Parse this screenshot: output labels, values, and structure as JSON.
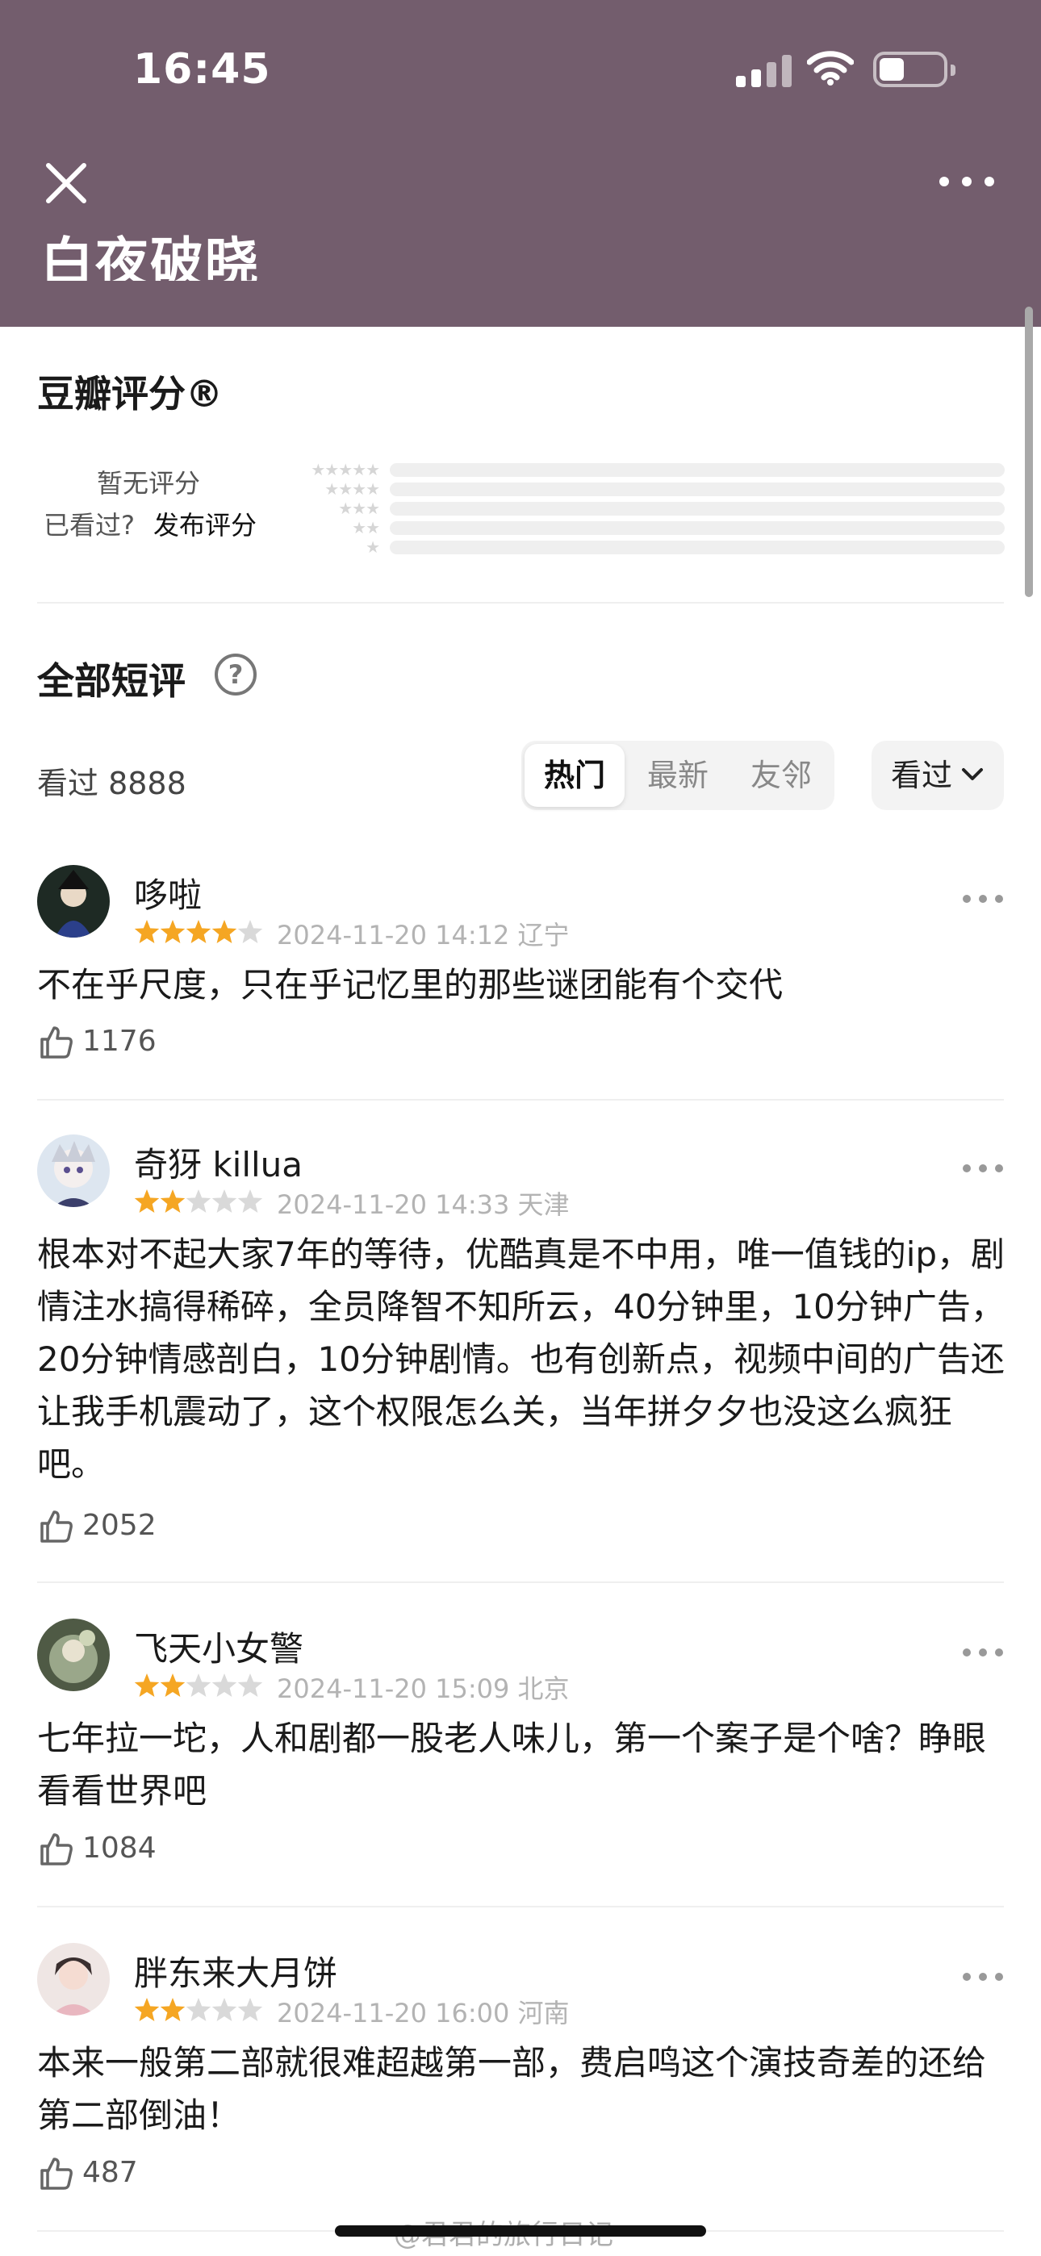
{
  "status_bar": {
    "time": "16:45"
  },
  "header": {
    "title": "白夜破晓"
  },
  "rating": {
    "title": "豆瓣评分®",
    "no_rating": "暂无评分",
    "watched_question": "已看过?",
    "publish": "发布评分",
    "star_rows": [
      "★★★★★",
      "★★★★",
      "★★★",
      "★★",
      "★"
    ]
  },
  "comments_section": {
    "title": "全部短评",
    "help": "?",
    "watched_label": "看过 8888",
    "tabs": [
      "热门",
      "最新",
      "友邻"
    ],
    "active_tab": "热门",
    "filter": "看过"
  },
  "comments": [
    {
      "username": "哆啦",
      "rating": 4,
      "date": "2024-11-20 14:12",
      "location": "辽宁",
      "text": "不在乎尺度，只在乎记忆里的那些谜团能有个交代",
      "likes": "1176"
    },
    {
      "username": "奇犽 killua",
      "rating": 2,
      "date": "2024-11-20 14:33",
      "location": "天津",
      "text": "根本对不起大家7年的等待，优酷真是不中用，唯一值钱的ip，剧情注水搞得稀碎，全员降智不知所云，40分钟里，10分钟广告，20分钟情感剖白，10分钟剧情。也有创新点，视频中间的广告还让我手机震动了，这个权限怎么关，当年拼夕夕也没这么疯狂吧。",
      "likes": "2052"
    },
    {
      "username": "飞天小女警",
      "rating": 2,
      "date": "2024-11-20 15:09",
      "location": "北京",
      "text": "七年拉一坨，人和剧都一股老人味儿，第一个案子是个啥？睁眼看看世界吧",
      "likes": "1084"
    },
    {
      "username": "胖东来大月饼",
      "rating": 2,
      "date": "2024-11-20 16:00",
      "location": "河南",
      "text": "本来一般第二部就很难超越第一部，费启鸣这个演技奇差的还给第二部倒油！",
      "likes": "487"
    }
  ],
  "watermark": "@君君的旅行日记",
  "colors": {
    "header": "#735d6d",
    "star": "#f5a623",
    "star_empty": "#d9d9d9"
  }
}
